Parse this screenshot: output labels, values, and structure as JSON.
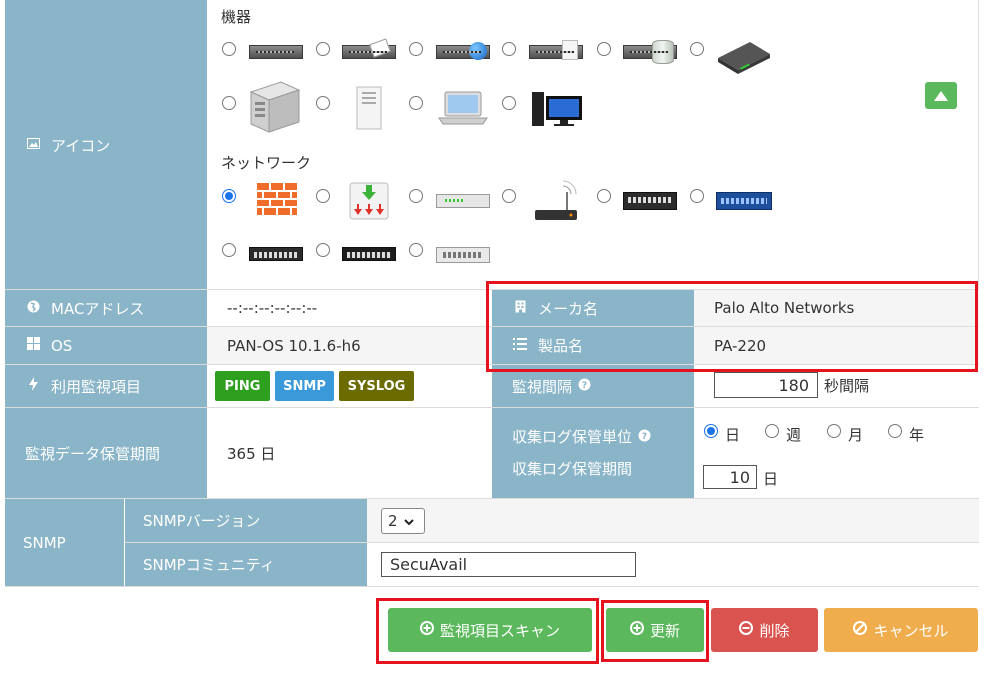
{
  "icon_row": {
    "label": "アイコン",
    "group_equipment": "機器",
    "group_network": "ネットワーク",
    "equipment_icons": [
      "rack-server-icon",
      "rack-server-mail-icon",
      "rack-server-globe-icon",
      "rack-server-document-icon",
      "rack-server-database-icon",
      "appliance-icon",
      "tower-server-icon",
      "tower-pc-icon",
      "laptop-icon",
      "desktop-pc-icon"
    ],
    "network_icons": [
      "firewall-icon",
      "load-balancer-icon",
      "switch-small-icon",
      "wifi-router-icon",
      "switch-large-icon",
      "switch-blue-icon",
      "switch-rack-icon",
      "switch-dark-icon",
      "hub-icon"
    ],
    "selected_network_index": 0
  },
  "mac": {
    "label": "MACアドレス",
    "value": "--:--:--:--:--:--"
  },
  "maker": {
    "label": "メーカ名",
    "value": "Palo Alto Networks"
  },
  "os": {
    "label": "OS",
    "value": "PAN-OS 10.1.6-h6"
  },
  "product": {
    "label": "製品名",
    "value": "PA-220"
  },
  "monitor_items": {
    "label": "利用監視項目",
    "badges": [
      "PING",
      "SNMP",
      "SYSLOG"
    ],
    "badge_colors": [
      "#2e9f1f",
      "#3a9ad9",
      "#6b6b00"
    ]
  },
  "interval": {
    "label": "監視間隔",
    "value": "180",
    "unit": "秒間隔"
  },
  "retention": {
    "label": "監視データ保管期間",
    "value": "365 日"
  },
  "log_unit": {
    "label": "収集ログ保管単位",
    "options": [
      "日",
      "週",
      "月",
      "年"
    ],
    "selected": "日"
  },
  "log_period": {
    "label": "収集ログ保管期間",
    "value": "10",
    "unit": "日"
  },
  "snmp": {
    "label": "SNMP",
    "version_label": "SNMPバージョン",
    "version_value": "2",
    "community_label": "SNMPコミュニティ",
    "community_value": "SecuAvail"
  },
  "buttons": {
    "scan": "監視項目スキャン",
    "update": "更新",
    "delete": "削除",
    "cancel": "キャンセル"
  },
  "colors": {
    "label_bg": "#8ab4c7",
    "green": "#5cb85c",
    "red": "#d9534f",
    "orange": "#f0ad4e",
    "highlight": "#e4131f"
  }
}
